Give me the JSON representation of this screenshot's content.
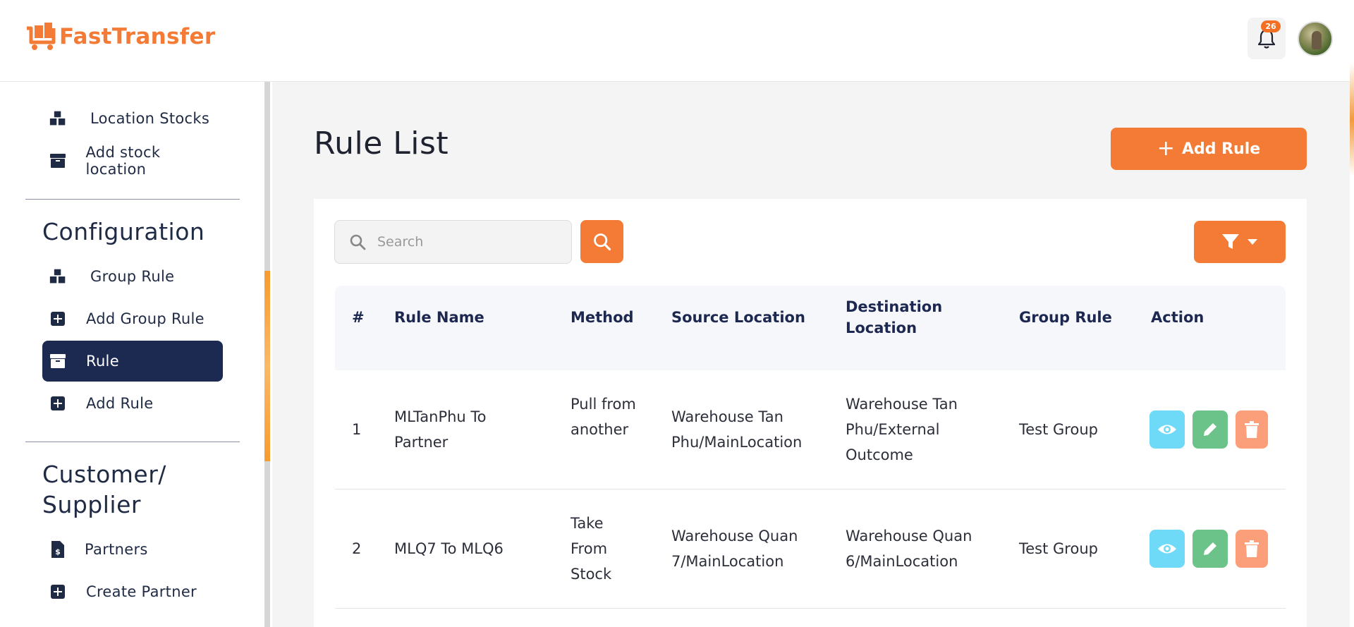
{
  "brand": {
    "name": "FastTransfer",
    "color": "#f47b35"
  },
  "header": {
    "notification_count": "26"
  },
  "sidebar": {
    "items_top": [
      {
        "label": "Location Stocks",
        "icon": "boxes-icon"
      },
      {
        "label": "Add stock location",
        "icon": "box-icon"
      }
    ],
    "section_config": "Configuration",
    "items_config": [
      {
        "label": "Group Rule",
        "icon": "boxes-icon"
      },
      {
        "label": "Add Group Rule",
        "icon": "plus-square-icon"
      },
      {
        "label": "Rule",
        "icon": "box-icon",
        "active": true
      },
      {
        "label": "Add Rule",
        "icon": "plus-square-icon"
      }
    ],
    "section_customer": "Customer/\nSupplier",
    "items_customer": [
      {
        "label": "Partners",
        "icon": "invoice-dollar-icon"
      },
      {
        "label": "Create Partner",
        "icon": "plus-square-icon"
      }
    ]
  },
  "main": {
    "title": "Rule List",
    "add_button": "Add Rule",
    "search_placeholder": "Search"
  },
  "table": {
    "headers": [
      "#",
      "Rule Name",
      "Method",
      "Source Location",
      "Destination Location",
      "Group Rule",
      "Action"
    ],
    "rows": [
      {
        "num": "1",
        "name": "MLTanPhu To Partner",
        "method": "Pull from another",
        "source": "Warehouse Tan Phu/MainLocation",
        "destination": "Warehouse Tan Phu/External Outcome",
        "group": "Test Group"
      },
      {
        "num": "2",
        "name": "MLQ7 To MLQ6",
        "method": "Take From Stock",
        "source": "Warehouse Quan 7/MainLocation",
        "destination": "Warehouse Quan 6/MainLocation",
        "group": "Test Group"
      }
    ]
  },
  "colors": {
    "accent": "#f47b35",
    "nav_active": "#1c2a52",
    "view": "#6fd9f8",
    "edit": "#6cc38a",
    "delete": "#fb9e7a"
  }
}
